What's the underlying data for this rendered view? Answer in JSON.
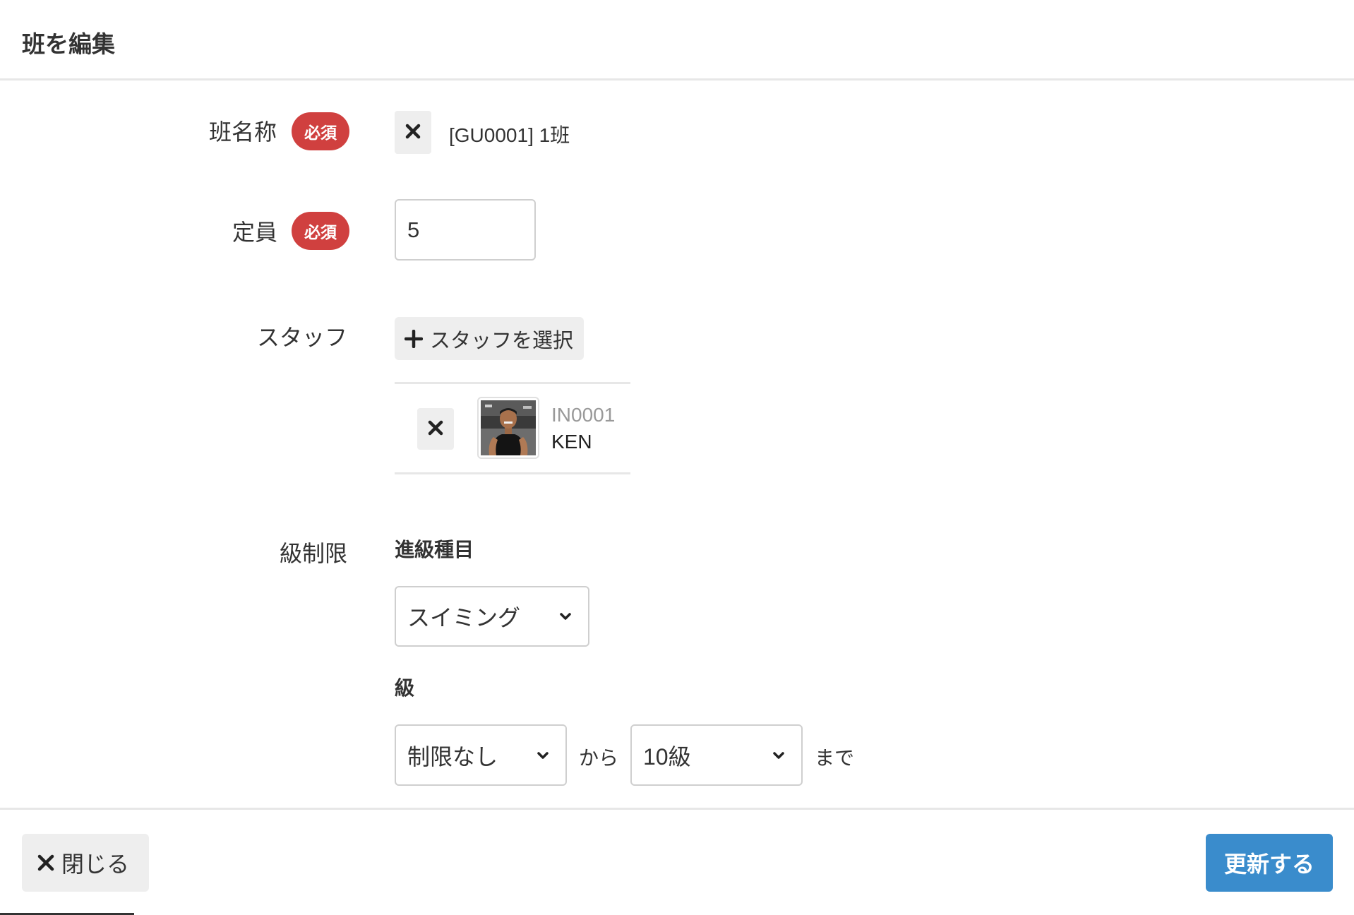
{
  "modal": {
    "title": "班を編集"
  },
  "form": {
    "group_name": {
      "label": "班名称",
      "required_badge": "必須",
      "value": "[GU0001] 1班",
      "clear_icon": "close-icon"
    },
    "capacity": {
      "label": "定員",
      "required_badge": "必須",
      "value": "5"
    },
    "staff": {
      "label": "スタッフ",
      "select_button_label": "スタッフを選択",
      "select_button_icon": "plus-icon",
      "members": [
        {
          "code": "IN0001",
          "name": "KEN",
          "remove_icon": "close-icon",
          "avatar": "staff-photo"
        }
      ]
    },
    "grade_limit": {
      "label": "級制限",
      "event_label": "進級種目",
      "event_value": "スイミング",
      "grade_label": "級",
      "from_value": "制限なし",
      "from_text": "から",
      "to_value": "10級",
      "to_text": "まで"
    }
  },
  "footer": {
    "close_label": "閉じる",
    "close_icon": "close-icon",
    "submit_label": "更新する"
  },
  "colors": {
    "required_badge": "#d0403f",
    "primary_button": "#3a8ccc",
    "gray_button": "#eeeeee",
    "border": "#cfcfcf"
  }
}
